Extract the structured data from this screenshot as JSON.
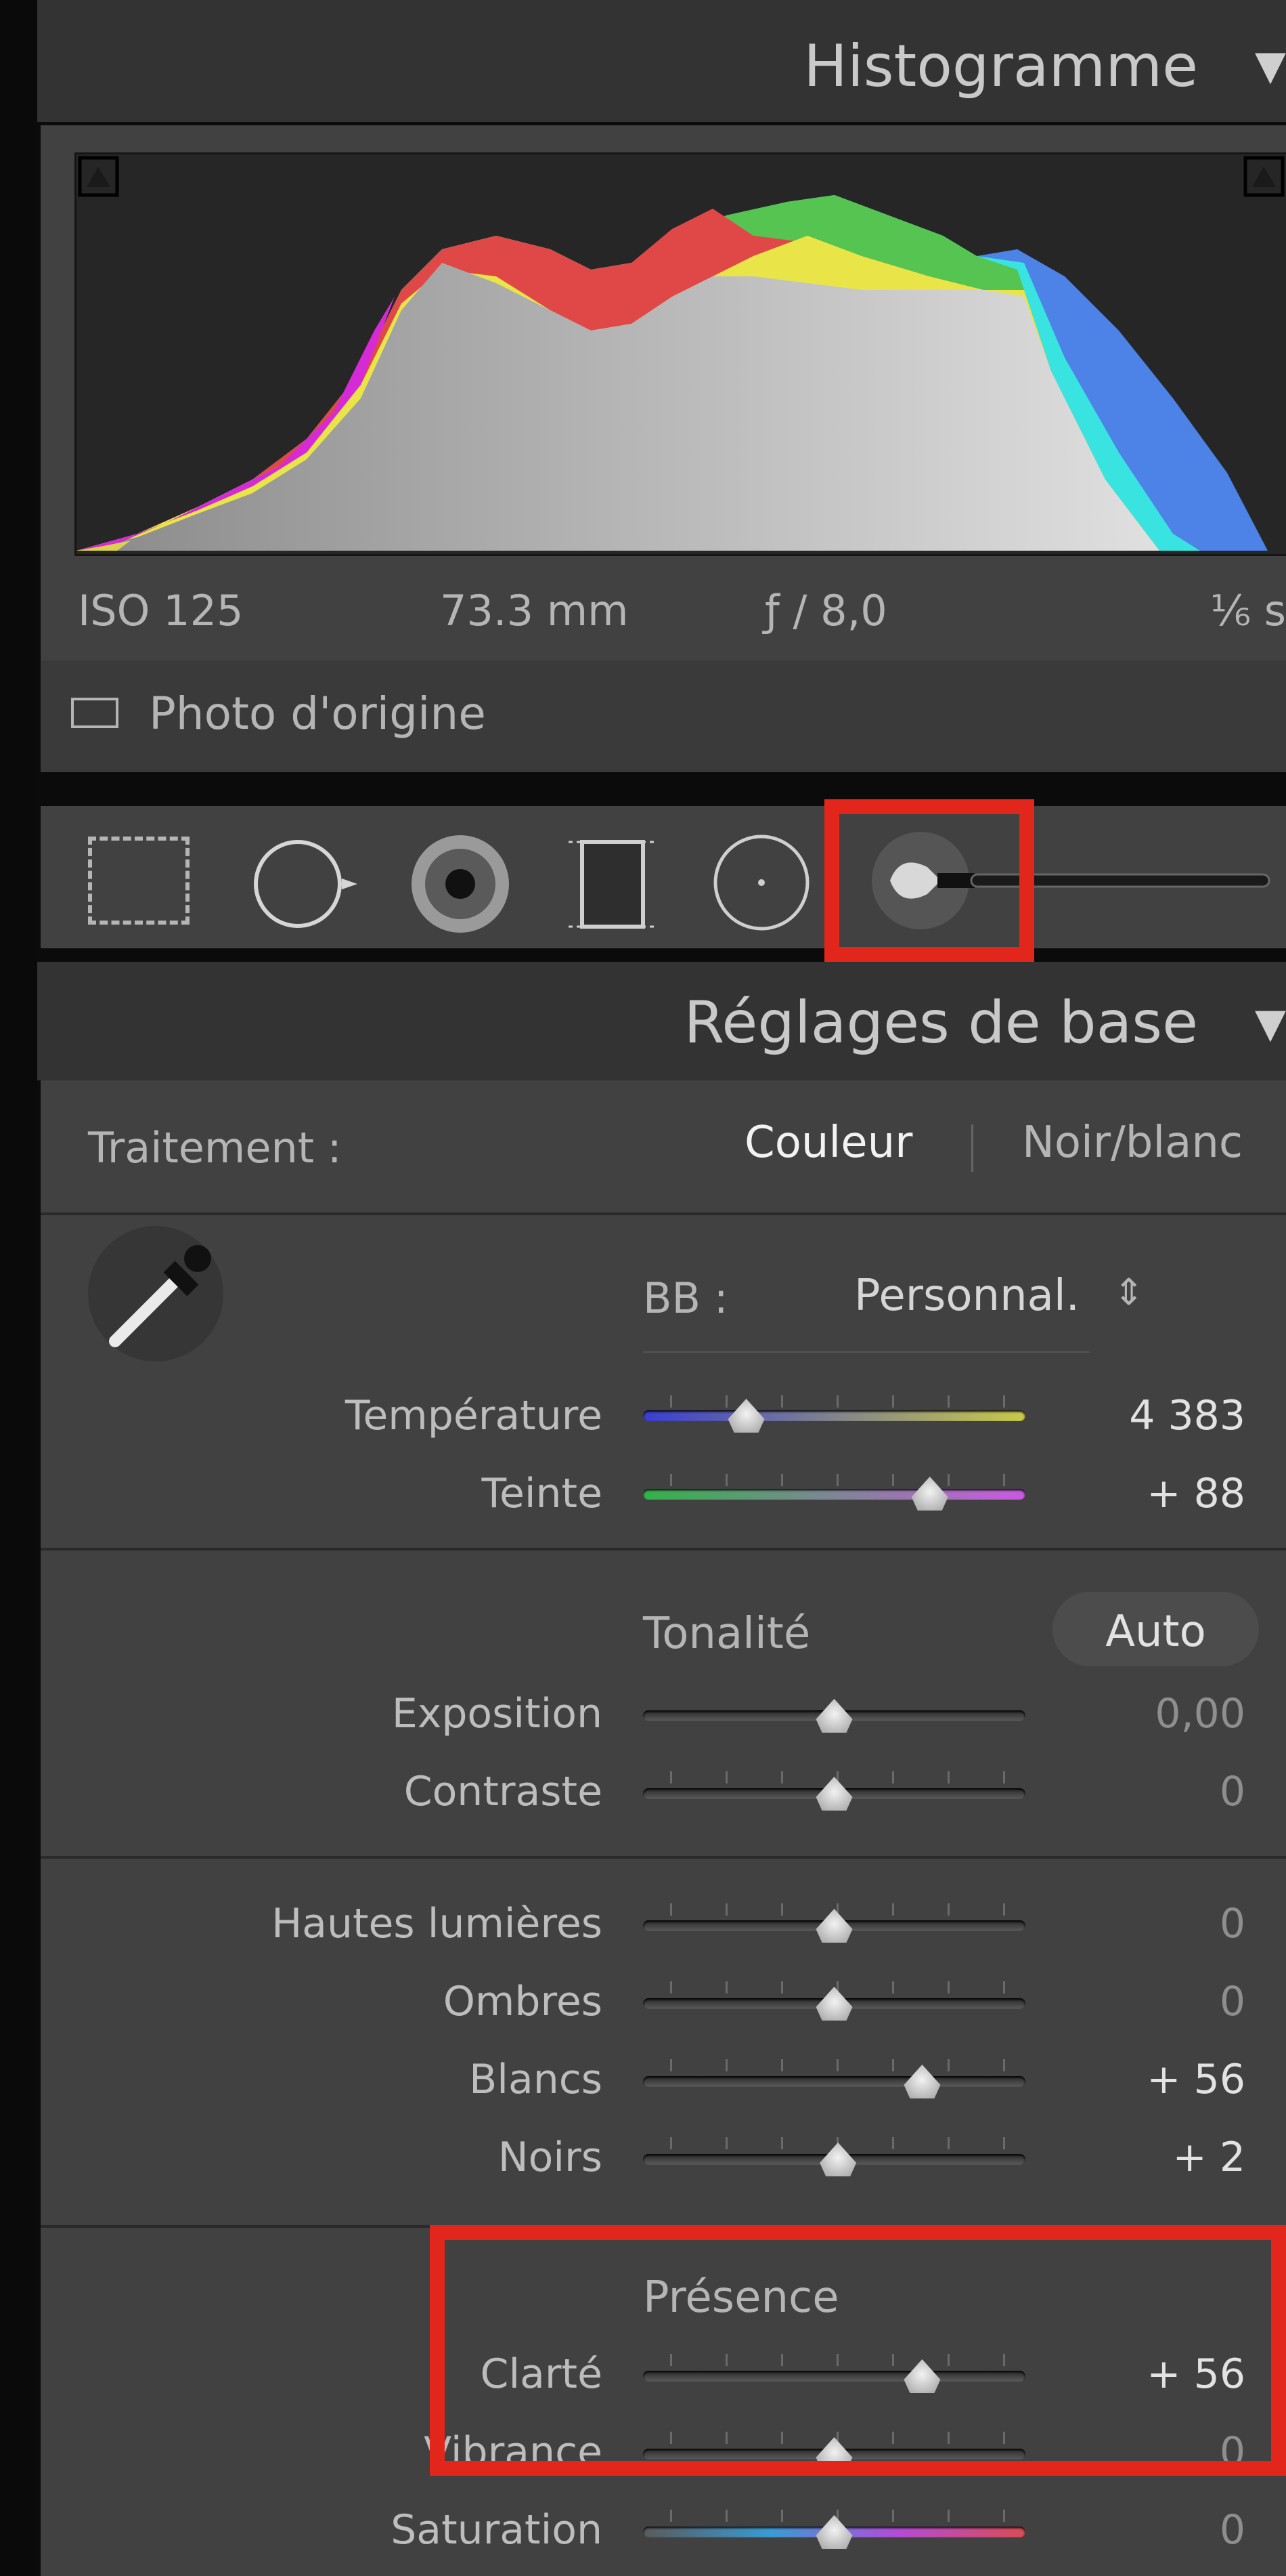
{
  "histogram": {
    "title": "Histogramme",
    "iso": "ISO 125",
    "focal": "73.3 mm",
    "aperture": "ƒ / 8,0",
    "shutter": "⅙ s",
    "original_photo_label": "Photo d'origine"
  },
  "tools": [
    "crop-overlay-icon",
    "spot-removal-icon",
    "red-eye-icon",
    "graduated-filter-icon",
    "radial-filter-icon",
    "adjustment-brush-icon"
  ],
  "basic": {
    "title": "Réglages de base",
    "treatment_label": "Traitement :",
    "color_label": "Couleur",
    "bw_label": "Noir/blanc",
    "wb_label": "BB :",
    "wb_value": "Personnal.",
    "tone_label": "Tonalité",
    "auto_label": "Auto",
    "presence_label": "Présence",
    "temperature": {
      "label": "Température",
      "value": "4 383",
      "level": 0.27
    },
    "tint": {
      "label": "Teinte",
      "value": "+ 88",
      "level": 0.75
    },
    "exposure": {
      "label": "Exposition",
      "value": "0,00",
      "level": 0.5
    },
    "contrast": {
      "label": "Contraste",
      "value": "0",
      "level": 0.5
    },
    "highlights": {
      "label": "Hautes lumières",
      "value": "0",
      "level": 0.5
    },
    "shadows": {
      "label": "Ombres",
      "value": "0",
      "level": 0.5
    },
    "whites": {
      "label": "Blancs",
      "value": "+ 56",
      "level": 0.73
    },
    "blacks": {
      "label": "Noirs",
      "value": "+ 2",
      "level": 0.51
    },
    "clarity": {
      "label": "Clarté",
      "value": "+ 56",
      "level": 0.73
    },
    "vibrance": {
      "label": "Vibrance",
      "value": "0",
      "level": 0.5
    },
    "saturation": {
      "label": "Saturation",
      "value": "0",
      "level": 0.5
    }
  },
  "colors": {
    "highlight_box": "#e2261c",
    "panel": "#414141"
  }
}
